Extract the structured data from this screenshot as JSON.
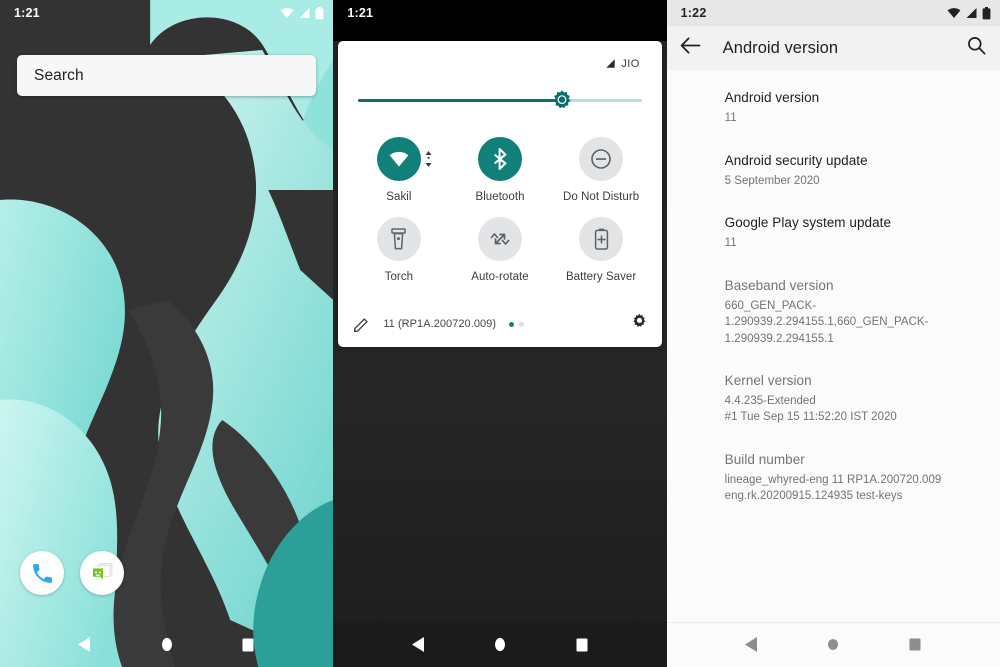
{
  "panels": {
    "home": {
      "status": {
        "time": "1:21",
        "icons": [
          "wifi-icon",
          "cellular-signal-icon",
          "battery-icon"
        ]
      },
      "search": {
        "placeholder": "Search",
        "value": ""
      },
      "dock": [
        {
          "name": "phone-app-icon",
          "label": "Phone"
        },
        {
          "name": "messaging-app-icon",
          "label": "Messaging"
        }
      ],
      "nav": [
        "back-button",
        "home-button",
        "recents-button"
      ]
    },
    "quicksettings": {
      "status": {
        "time": "1:21"
      },
      "carrier": {
        "label": "JIO",
        "icon": "cellular-signal-icon"
      },
      "brightness": {
        "name": "brightness-slider",
        "percent": 72,
        "icon": "brightness-icon"
      },
      "tiles": [
        {
          "name": "wifi-tile",
          "label": "Sakil",
          "icon": "wifi-icon",
          "state": "on",
          "expandable": true
        },
        {
          "name": "bluetooth-tile",
          "label": "Bluetooth",
          "icon": "bluetooth-icon",
          "state": "on",
          "expandable": false
        },
        {
          "name": "dnd-tile",
          "label": "Do Not Disturb",
          "icon": "do-not-disturb-icon",
          "state": "off",
          "expandable": false
        },
        {
          "name": "torch-tile",
          "label": "Torch",
          "icon": "flashlight-icon",
          "state": "off",
          "expandable": false
        },
        {
          "name": "autorotate-tile",
          "label": "Auto-rotate",
          "icon": "screen-rotation-icon",
          "state": "off",
          "expandable": false
        },
        {
          "name": "battery-saver-tile",
          "label": "Battery Saver",
          "icon": "battery-saver-icon",
          "state": "off",
          "expandable": false
        }
      ],
      "footer": {
        "edit_icon": "pencil-icon",
        "build": "11 (RP1A.200720.009)",
        "dots": [
          "active",
          "idle"
        ],
        "settings_icon": "gear-icon"
      },
      "nav": [
        "back-button",
        "home-button",
        "recents-button"
      ]
    },
    "settings": {
      "status": {
        "time": "1:22"
      },
      "appbar": {
        "back_icon": "back-arrow-icon",
        "title": "Android version",
        "search_icon": "search-icon"
      },
      "items": [
        {
          "title": "Android version",
          "sub": "11",
          "dim": false
        },
        {
          "title": "Android security update",
          "sub": "5 September 2020",
          "dim": false
        },
        {
          "title": "Google Play system update",
          "sub": "11",
          "dim": false
        },
        {
          "title": "Baseband version",
          "sub": "660_GEN_PACK-1.290939.2.294155.1,660_GEN_PACK-1.290939.2.294155.1",
          "dim": true
        },
        {
          "title": "Kernel version",
          "sub": "4.4.235-Extended\n#1 Tue Sep 15 11:52:20 IST 2020",
          "dim": true
        },
        {
          "title": "Build number",
          "sub": "lineage_whyred-eng 11 RP1A.200720.009 eng.rk.20200915.124935 test-keys",
          "dim": true
        }
      ],
      "nav": [
        "back-button",
        "home-button",
        "recents-button"
      ]
    }
  },
  "colors": {
    "accent_teal": "#12807a",
    "slider_teal": "#0b6e69",
    "wallpaper_dark": "#333333",
    "wallpaper_mint": "#a8eae4",
    "qs_dark": "#242424",
    "settings_bg": "#fbfbfb"
  }
}
